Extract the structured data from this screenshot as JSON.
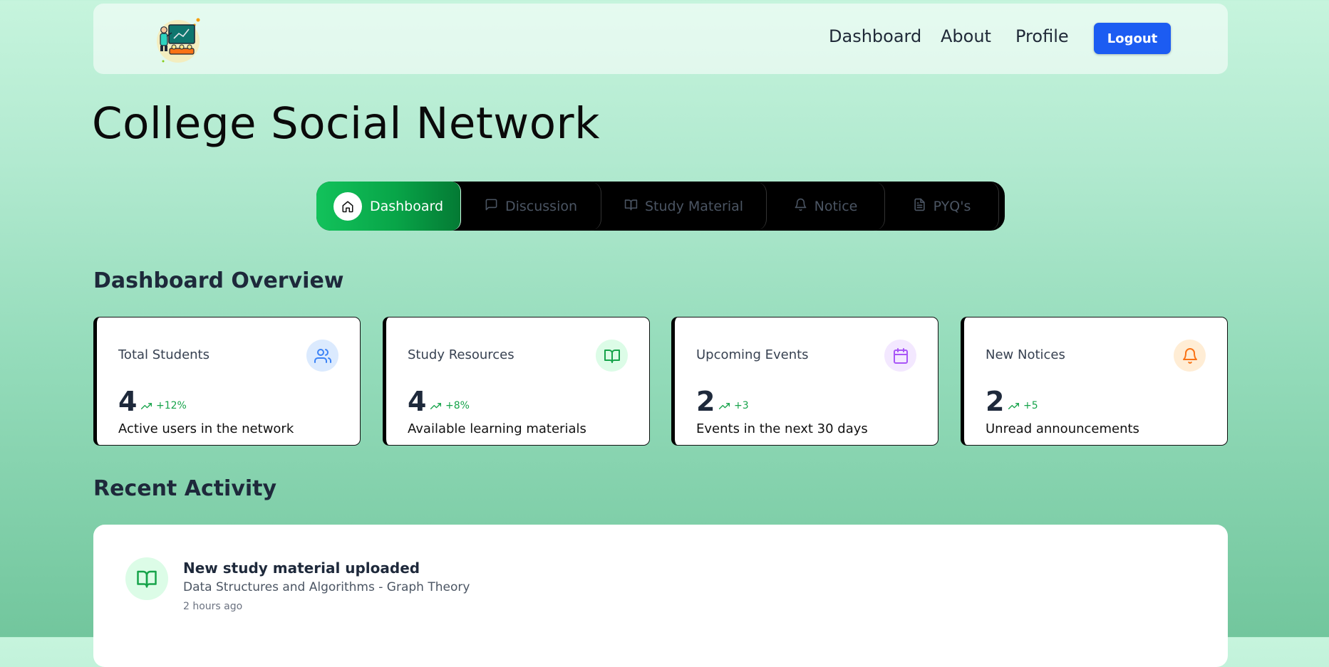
{
  "navbar": {
    "logo_icon": "teacher-classroom-logo-icon",
    "links": [
      {
        "label": "Dashboard"
      },
      {
        "label": "About"
      },
      {
        "label": "Profile"
      }
    ],
    "logout_label": "Logout",
    "logout_color": "#1c5cf2"
  },
  "page_title": "College Social Network",
  "tabs": [
    {
      "label": "Dashboard",
      "icon": "home-icon",
      "active": true
    },
    {
      "label": "Discussion",
      "icon": "message-square-icon",
      "active": false
    },
    {
      "label": "Study Material",
      "icon": "book-open-icon",
      "active": false
    },
    {
      "label": "Notice",
      "icon": "bell-icon",
      "active": false
    },
    {
      "label": "PYQ's",
      "icon": "file-text-icon",
      "active": false
    }
  ],
  "overview": {
    "title": "Dashboard Overview",
    "cards": [
      {
        "label": "Total Students",
        "value": "4",
        "trend": "+12%",
        "description": "Active users in the network",
        "icon": "users-icon",
        "icon_color": "#3b82f6",
        "icon_bg": "#dbeafe"
      },
      {
        "label": "Study Resources",
        "value": "4",
        "trend": "+8%",
        "description": "Available learning materials",
        "icon": "book-open-icon",
        "icon_color": "#16a34a",
        "icon_bg": "#dcfce7"
      },
      {
        "label": "Upcoming Events",
        "value": "2",
        "trend": "+3",
        "description": "Events in the next 30 days",
        "icon": "calendar-icon",
        "icon_color": "#a855f7",
        "icon_bg": "#f3e8ff"
      },
      {
        "label": "New Notices",
        "value": "2",
        "trend": "+5",
        "description": "Unread announcements",
        "icon": "bell-icon",
        "icon_color": "#f97316",
        "icon_bg": "#ffedd5"
      }
    ]
  },
  "recent_activity": {
    "title": "Recent Activity",
    "items": [
      {
        "title": "New study material uploaded",
        "description": "Data Structures and Algorithms - Graph Theory",
        "time": "2 hours ago",
        "icon": "book-open-icon"
      }
    ]
  }
}
